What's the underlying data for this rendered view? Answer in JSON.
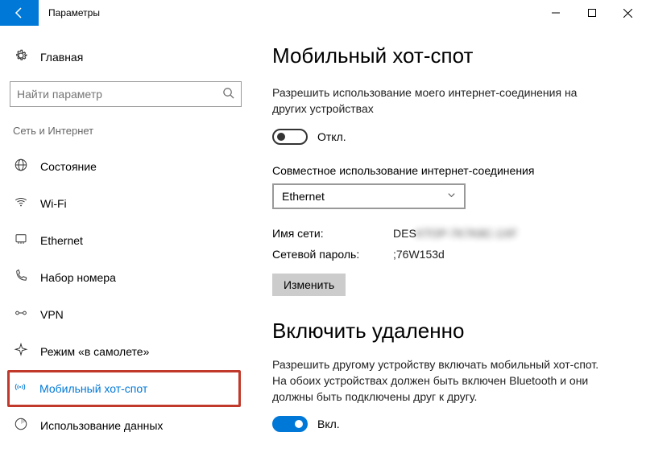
{
  "window": {
    "title": "Параметры"
  },
  "sidebar": {
    "home_label": "Главная",
    "search_placeholder": "Найти параметр",
    "category": "Сеть и Интернет",
    "items": [
      {
        "label": "Состояние"
      },
      {
        "label": "Wi-Fi"
      },
      {
        "label": "Ethernet"
      },
      {
        "label": "Набор номера"
      },
      {
        "label": "VPN"
      },
      {
        "label": "Режим «в самолете»"
      },
      {
        "label": "Мобильный хот-спот"
      },
      {
        "label": "Использование данных"
      }
    ]
  },
  "main": {
    "title": "Мобильный хот-спот",
    "share_description": "Разрешить использование моего интернет-соединения на других устройствах",
    "share_toggle_label": "Откл.",
    "connection_label": "Совместное использование интернет-соединения",
    "connection_value": "Ethernet",
    "network_name_label": "Имя сети:",
    "network_name_value": "DES",
    "network_password_label": "Сетевой пароль:",
    "network_password_value": ";76W153d",
    "edit_button": "Изменить",
    "remote_section_title": "Включить удаленно",
    "remote_description": "Разрешить другому устройству включать мобильный хот-спот. На обоих устройствах должен быть включен Bluetooth и они должны быть подключены друг к другу.",
    "remote_toggle_label": "Вкл."
  }
}
